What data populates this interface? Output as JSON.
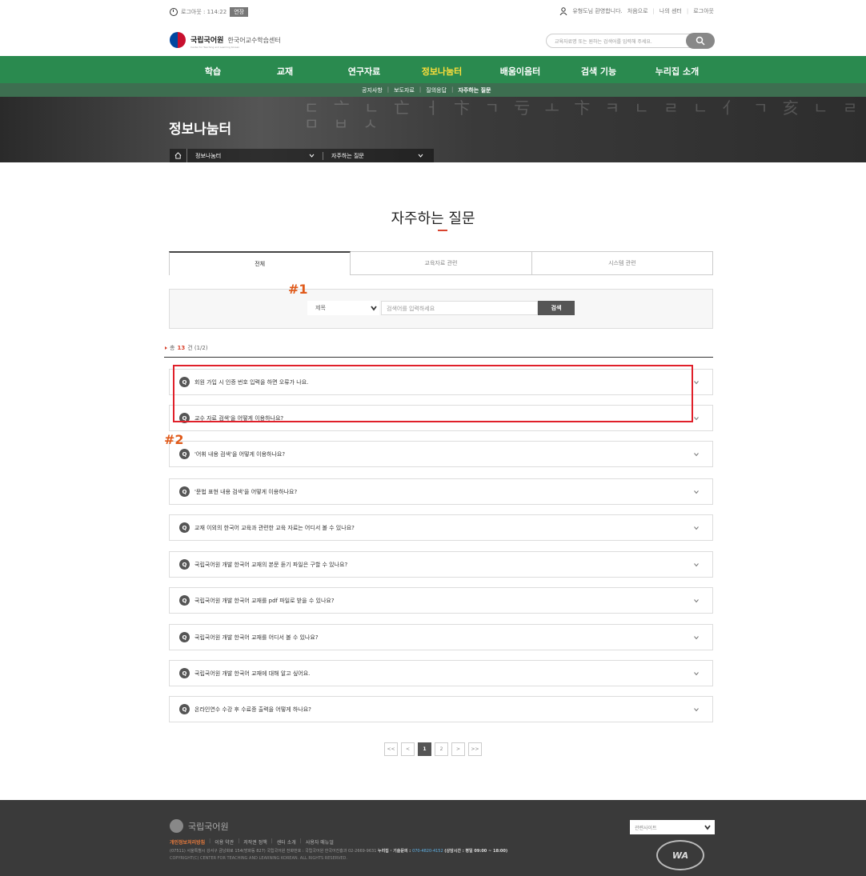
{
  "util": {
    "timer": "로그아웃 : 114:22",
    "extend_label": "연장",
    "welcome": "유형도님 환영합니다.",
    "links": [
      "처음으로",
      "나의 센터",
      "로그아웃"
    ]
  },
  "header": {
    "org": "국립국어원",
    "center": "한국어교수학습센터",
    "center_en": "Center for Teaching and Learning Korean",
    "search_placeholder": "교육자료명 또는 원하는 검색어를 입력해 주세요."
  },
  "gnb": [
    "학습",
    "교재",
    "연구자료",
    "정보나눔터",
    "배움이음터",
    "검색 기능",
    "누리집 소개"
  ],
  "gnb_active": "정보나눔터",
  "subnav": [
    "공지사항",
    "보도자료",
    "질의응답",
    "자주하는 질문"
  ],
  "hero": {
    "title": "정보나눔터",
    "glyphs": "ㄷ 亠 ㄴ 亡 ㅓ 卞 ㄱ 亏 ㅗ 卞 ㅋ ㄴ ㄹ ㄴ 亻 ㄱ 亥 ㄴ ㄹ ㅁ ㅂ ㅅ",
    "breadcrumb": [
      "정보나눔터",
      "자주하는 질문"
    ]
  },
  "page_title": "자주하는 질문",
  "tabs": [
    "전체",
    "교육자료 관련",
    "시스템 관련"
  ],
  "search": {
    "select_value": "제목",
    "placeholder": "검색어를 입력하세요",
    "button": "검색"
  },
  "count": {
    "prefix": "총",
    "num": "13",
    "suffix": "건 (1/2)"
  },
  "faq": [
    "회원 가입 시 인증 번호 입력을 하면 오류가 나요.",
    "교수 자료 검색'을 어떻게 이용하나요?",
    "'어휘 내용 검색'을 어떻게 이용하나요?",
    "'문법 표현 내용 검색'을 어떻게 이용하나요?",
    "교재 이외의 한국어 교육과 관련한 교육 자료는 어디서 볼 수 있나요?",
    "국립국어원 개발 한국어 교재의 본문 듣기 파일은 구할 수 있나요?",
    "국립국어원 개발 한국어 교재를 pdf 파일로 받을 수 있나요?",
    "국립국어원 개발 한국어 교재를 어디서 볼 수 있나요?",
    "국립국어원 개발 한국어 교재에 대해 알고 싶어요.",
    "온라인연수 수강 후 수료증 출력을 어떻게 하나요?"
  ],
  "badge": "Q",
  "annotations": [
    "#1",
    "#2"
  ],
  "pager": [
    "<<",
    "<",
    "1",
    "2",
    ">",
    ">>"
  ],
  "footer": {
    "org": "국립국어원",
    "links": [
      "개인정보처리방침",
      "이용 약관",
      "저작권 정책",
      "센터 소개",
      "사용자 매뉴얼"
    ],
    "address": "(07511) 서울특별시 강서구 금낭화로 154(방화동 827) 국립국어원   전화번호 : 국립국어원 한국어진흥과 02-2669-9631   ",
    "helpdesk_label": "누리집 · 기술문의 : ",
    "helpdesk_tel": "070-4820-4152",
    "hours": " (상담시간 : 평일 09:00 ~ 18:00)",
    "copyright": "COPYRIGHT(C) CENTER FOR TEACHING AND LEARNING KOREAN. ALL RIGHTS RESERVED.",
    "family_select": "관련사이트",
    "wa_label": "WA"
  },
  "colors": {
    "nav_green": "#2a8a4f",
    "active_yellow": "#ffdf3a",
    "accent_red": "#d9442f",
    "annotation_red": "#e0202a"
  }
}
